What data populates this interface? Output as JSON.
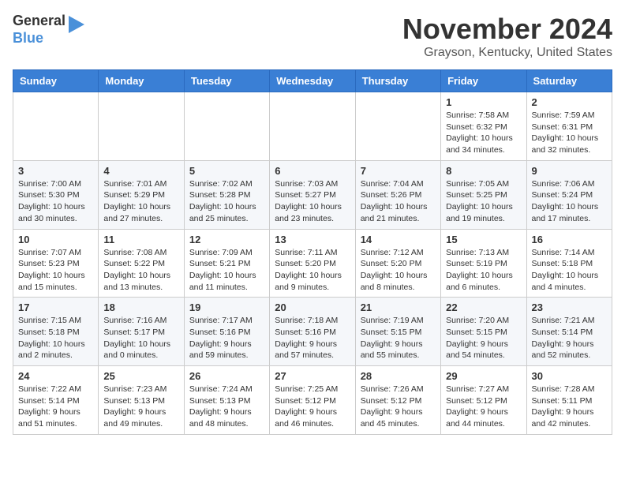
{
  "header": {
    "logo": {
      "line1": "General",
      "line2": "Blue"
    },
    "title": "November 2024",
    "location": "Grayson, Kentucky, United States"
  },
  "calendar": {
    "days_of_week": [
      "Sunday",
      "Monday",
      "Tuesday",
      "Wednesday",
      "Thursday",
      "Friday",
      "Saturday"
    ],
    "weeks": [
      [
        {
          "day": "",
          "info": ""
        },
        {
          "day": "",
          "info": ""
        },
        {
          "day": "",
          "info": ""
        },
        {
          "day": "",
          "info": ""
        },
        {
          "day": "",
          "info": ""
        },
        {
          "day": "1",
          "info": "Sunrise: 7:58 AM\nSunset: 6:32 PM\nDaylight: 10 hours\nand 34 minutes."
        },
        {
          "day": "2",
          "info": "Sunrise: 7:59 AM\nSunset: 6:31 PM\nDaylight: 10 hours\nand 32 minutes."
        }
      ],
      [
        {
          "day": "3",
          "info": "Sunrise: 7:00 AM\nSunset: 5:30 PM\nDaylight: 10 hours\nand 30 minutes."
        },
        {
          "day": "4",
          "info": "Sunrise: 7:01 AM\nSunset: 5:29 PM\nDaylight: 10 hours\nand 27 minutes."
        },
        {
          "day": "5",
          "info": "Sunrise: 7:02 AM\nSunset: 5:28 PM\nDaylight: 10 hours\nand 25 minutes."
        },
        {
          "day": "6",
          "info": "Sunrise: 7:03 AM\nSunset: 5:27 PM\nDaylight: 10 hours\nand 23 minutes."
        },
        {
          "day": "7",
          "info": "Sunrise: 7:04 AM\nSunset: 5:26 PM\nDaylight: 10 hours\nand 21 minutes."
        },
        {
          "day": "8",
          "info": "Sunrise: 7:05 AM\nSunset: 5:25 PM\nDaylight: 10 hours\nand 19 minutes."
        },
        {
          "day": "9",
          "info": "Sunrise: 7:06 AM\nSunset: 5:24 PM\nDaylight: 10 hours\nand 17 minutes."
        }
      ],
      [
        {
          "day": "10",
          "info": "Sunrise: 7:07 AM\nSunset: 5:23 PM\nDaylight: 10 hours\nand 15 minutes."
        },
        {
          "day": "11",
          "info": "Sunrise: 7:08 AM\nSunset: 5:22 PM\nDaylight: 10 hours\nand 13 minutes."
        },
        {
          "day": "12",
          "info": "Sunrise: 7:09 AM\nSunset: 5:21 PM\nDaylight: 10 hours\nand 11 minutes."
        },
        {
          "day": "13",
          "info": "Sunrise: 7:11 AM\nSunset: 5:20 PM\nDaylight: 10 hours\nand 9 minutes."
        },
        {
          "day": "14",
          "info": "Sunrise: 7:12 AM\nSunset: 5:20 PM\nDaylight: 10 hours\nand 8 minutes."
        },
        {
          "day": "15",
          "info": "Sunrise: 7:13 AM\nSunset: 5:19 PM\nDaylight: 10 hours\nand 6 minutes."
        },
        {
          "day": "16",
          "info": "Sunrise: 7:14 AM\nSunset: 5:18 PM\nDaylight: 10 hours\nand 4 minutes."
        }
      ],
      [
        {
          "day": "17",
          "info": "Sunrise: 7:15 AM\nSunset: 5:18 PM\nDaylight: 10 hours\nand 2 minutes."
        },
        {
          "day": "18",
          "info": "Sunrise: 7:16 AM\nSunset: 5:17 PM\nDaylight: 10 hours\nand 0 minutes."
        },
        {
          "day": "19",
          "info": "Sunrise: 7:17 AM\nSunset: 5:16 PM\nDaylight: 9 hours\nand 59 minutes."
        },
        {
          "day": "20",
          "info": "Sunrise: 7:18 AM\nSunset: 5:16 PM\nDaylight: 9 hours\nand 57 minutes."
        },
        {
          "day": "21",
          "info": "Sunrise: 7:19 AM\nSunset: 5:15 PM\nDaylight: 9 hours\nand 55 minutes."
        },
        {
          "day": "22",
          "info": "Sunrise: 7:20 AM\nSunset: 5:15 PM\nDaylight: 9 hours\nand 54 minutes."
        },
        {
          "day": "23",
          "info": "Sunrise: 7:21 AM\nSunset: 5:14 PM\nDaylight: 9 hours\nand 52 minutes."
        }
      ],
      [
        {
          "day": "24",
          "info": "Sunrise: 7:22 AM\nSunset: 5:14 PM\nDaylight: 9 hours\nand 51 minutes."
        },
        {
          "day": "25",
          "info": "Sunrise: 7:23 AM\nSunset: 5:13 PM\nDaylight: 9 hours\nand 49 minutes."
        },
        {
          "day": "26",
          "info": "Sunrise: 7:24 AM\nSunset: 5:13 PM\nDaylight: 9 hours\nand 48 minutes."
        },
        {
          "day": "27",
          "info": "Sunrise: 7:25 AM\nSunset: 5:12 PM\nDaylight: 9 hours\nand 46 minutes."
        },
        {
          "day": "28",
          "info": "Sunrise: 7:26 AM\nSunset: 5:12 PM\nDaylight: 9 hours\nand 45 minutes."
        },
        {
          "day": "29",
          "info": "Sunrise: 7:27 AM\nSunset: 5:12 PM\nDaylight: 9 hours\nand 44 minutes."
        },
        {
          "day": "30",
          "info": "Sunrise: 7:28 AM\nSunset: 5:11 PM\nDaylight: 9 hours\nand 42 minutes."
        }
      ]
    ]
  }
}
